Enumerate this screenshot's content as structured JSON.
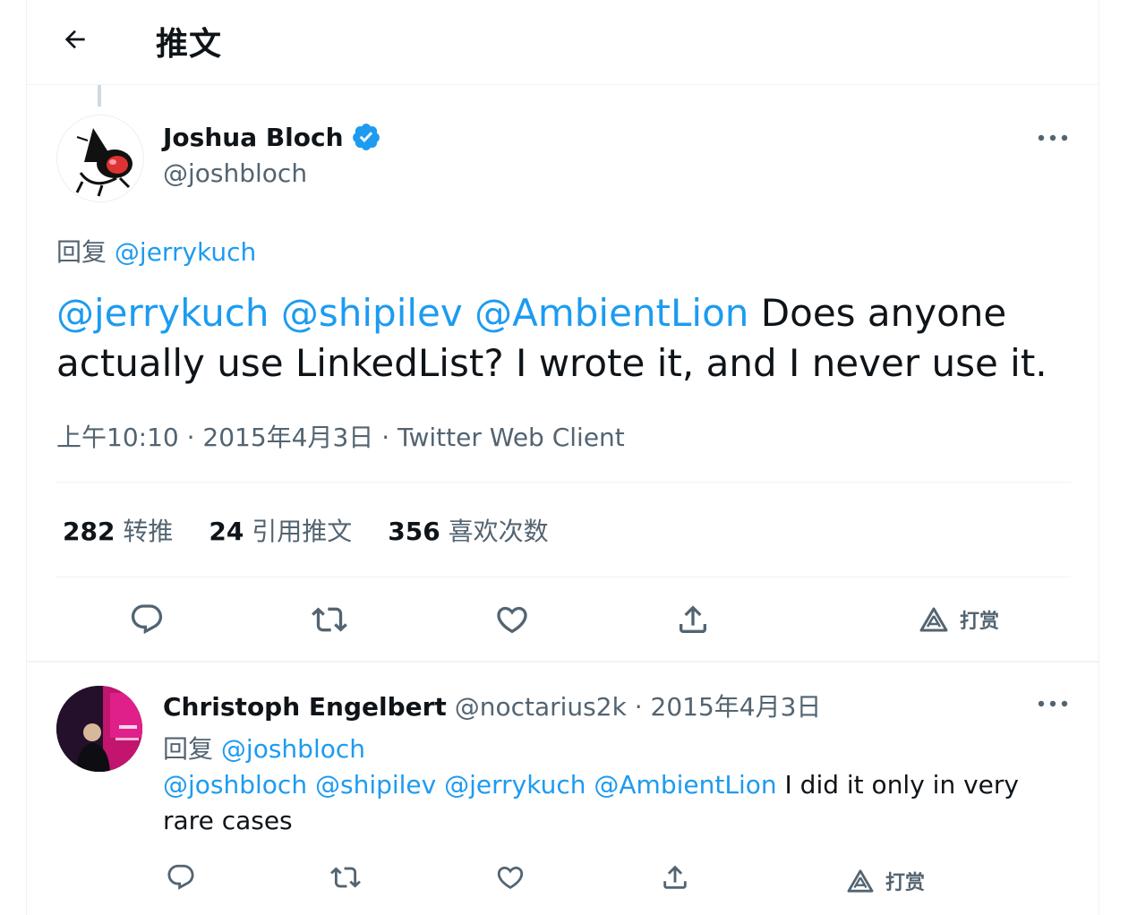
{
  "header": {
    "title": "推文"
  },
  "tweet": {
    "author_name": "Joshua Bloch",
    "author_handle": "@joshbloch",
    "reply_to_prefix": "回复",
    "reply_to_handle": "@jerrykuch",
    "mentions": [
      "@jerrykuch",
      "@shipilev",
      "@AmbientLion"
    ],
    "text": "Does anyone actually use LinkedList?  I wrote it, and I never use it.",
    "time": "上午10:10",
    "date": "2015年4月3日",
    "source": "Twitter Web Client",
    "dot": "·",
    "stats": [
      {
        "count": "282",
        "label": "转推"
      },
      {
        "count": "24",
        "label": "引用推文"
      },
      {
        "count": "356",
        "label": "喜欢次数"
      }
    ],
    "tip_label": "打赏"
  },
  "reply": {
    "author_name": "Christoph Engelbert",
    "author_handle": "@noctarius2k",
    "date": "2015年4月3日",
    "dot": "·",
    "reply_to_prefix": "回复",
    "reply_to_handle": "@joshbloch",
    "mentions": [
      "@joshbloch",
      "@shipilev",
      "@jerrykuch",
      "@AmbientLion"
    ],
    "text": "I did it only in very rare cases",
    "tip_label": "打赏"
  },
  "colors": {
    "link": "#1d9bf0",
    "muted": "#536471",
    "text": "#0f1419",
    "verified": "#1d9bf0"
  }
}
